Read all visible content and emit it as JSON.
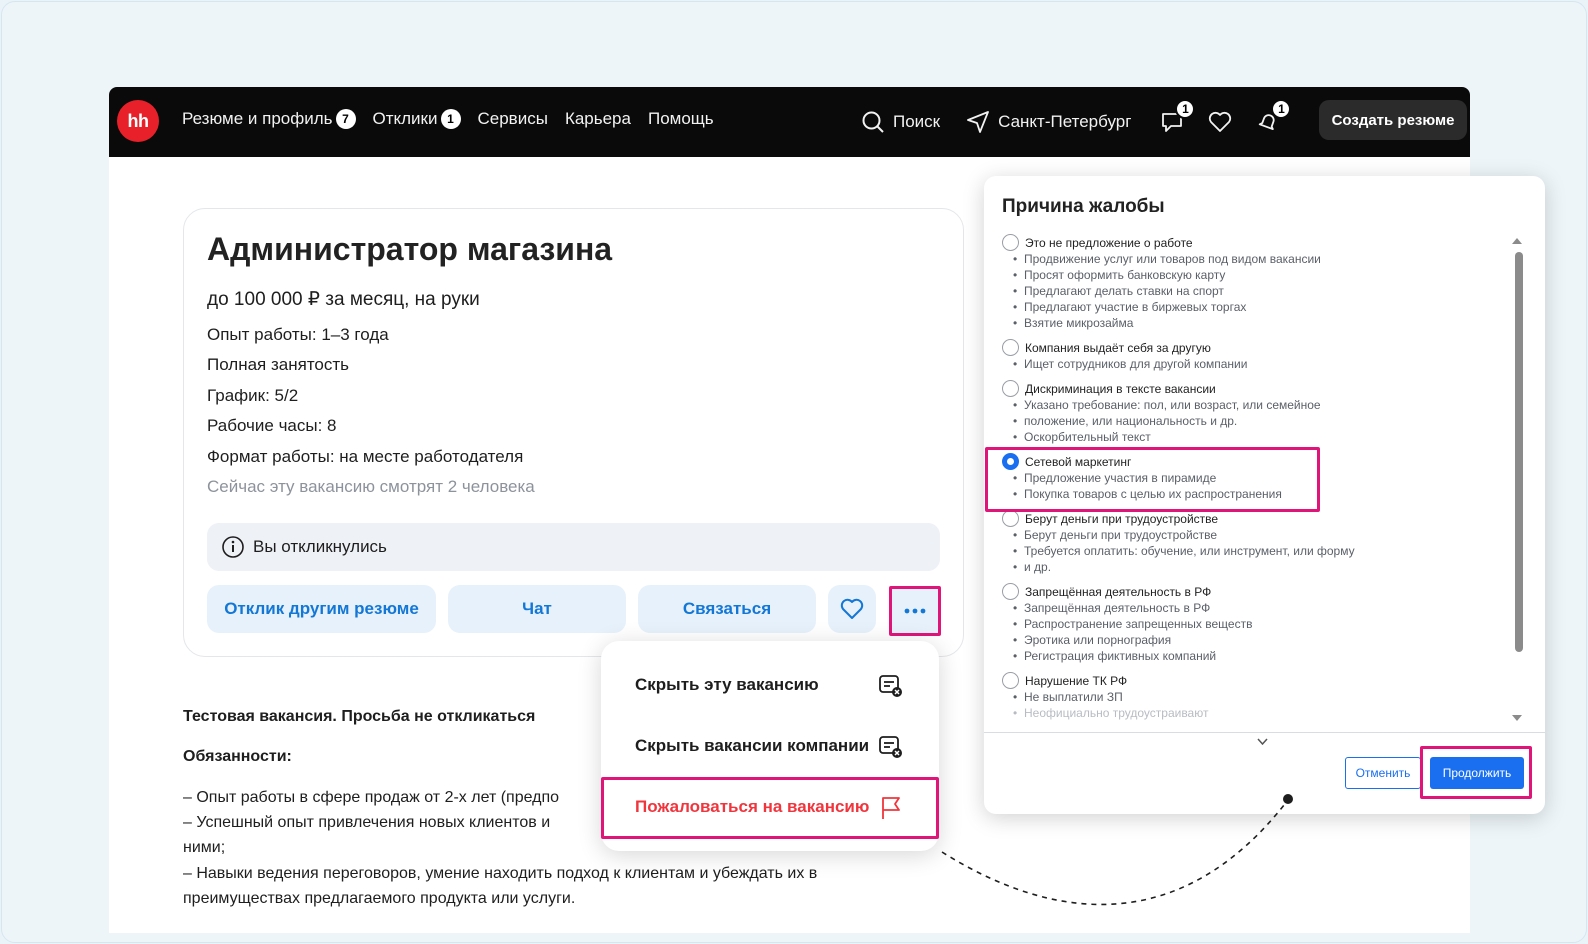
{
  "nav": {
    "logo": "hh",
    "links": [
      {
        "label": "Резюме и профиль",
        "badge": "7"
      },
      {
        "label": "Отклики",
        "badge": "1"
      },
      {
        "label": "Сервисы"
      },
      {
        "label": "Карьера"
      },
      {
        "label": "Помощь"
      }
    ],
    "search": "Поиск",
    "city": "Санкт-Петербург",
    "chat_badge": "1",
    "notif_badge": "1",
    "create_resume": "Создать резюме"
  },
  "vacancy": {
    "title": "Администратор магазина",
    "salary": "до 100 000 ₽ за месяц, на руки",
    "details": [
      "Опыт работы: 1–3 года",
      "Полная занятость",
      "График: 5/2",
      "Рабочие часы: 8",
      "Формат работы: на месте работодателя"
    ],
    "viewers": "Сейчас эту вакансию смотрят 2 человека",
    "responded": "Вы откликнулись",
    "buttons": {
      "other_resume": "Отклик другим резюме",
      "chat": "Чат",
      "contact": "Связаться"
    }
  },
  "description": {
    "heading": "Тестовая вакансия. Просьба не откликаться",
    "duties": "Обязанности:",
    "lines": [
      "– Опыт работы в сфере продаж от 2-х лет (предпо",
      "– Успешный опыт привлечения новых клиентов и",
      "ними;",
      "– Навыки ведения переговоров, умение находить подход к клиентам и убеждать их в",
      "преимуществах предлагаемого продукта или услуги."
    ]
  },
  "menu": {
    "hide_vacancy": "Скрыть эту вакансию",
    "hide_company": "Скрыть вакансии компании",
    "report": "Пожаловаться на вакансию"
  },
  "complaint": {
    "title": "Причина жалобы",
    "reasons": [
      {
        "label": "Это не предложение о работе",
        "items": [
          "Продвижение услуг или товаров под видом вакансии",
          "Просят оформить банковскую карту",
          "Предлагают делать ставки на спорт",
          "Предлагают участие в биржевых торгах",
          "Взятие микрозайма"
        ]
      },
      {
        "label": "Компания выдаёт себя за другую",
        "items": [
          "Ищет сотрудников для другой компании"
        ]
      },
      {
        "label": "Дискриминация в тексте вакансии",
        "items": [
          "Указано требование: пол, или возраст, или семейное",
          "положение, или национальность и др.",
          "Оскорбительный текст"
        ]
      },
      {
        "label": "Сетевой маркетинг",
        "items": [
          "Предложение участия в пирамиде",
          "Покупка товаров с целью их распространения"
        ],
        "selected": true
      },
      {
        "label": "Берут деньги при трудоустройстве",
        "items": [
          "Берут деньги при трудоустройстве",
          "Требуется оплатить: обучение, или инструмент, или форму",
          "и др."
        ]
      },
      {
        "label": "Запрещённая деятельность в РФ",
        "items": [
          "Запрещённая деятельность в РФ",
          "Распространение запрещенных веществ",
          "Эротика или порнография",
          "Регистрация фиктивных компаний"
        ]
      },
      {
        "label": "Нарушение ТК РФ",
        "items": [
          "Не выплатили ЗП",
          "Неофициально трудоустраивают"
        ]
      }
    ],
    "cancel": "Отменить",
    "continue": "Продолжить"
  },
  "colors": {
    "accent": "#1a6ff0",
    "link_blue": "#1377d6",
    "highlight": "#e0157a",
    "brand_red": "#e8202a",
    "report_red": "#f0353d",
    "navbar": "#0a0a0a"
  }
}
